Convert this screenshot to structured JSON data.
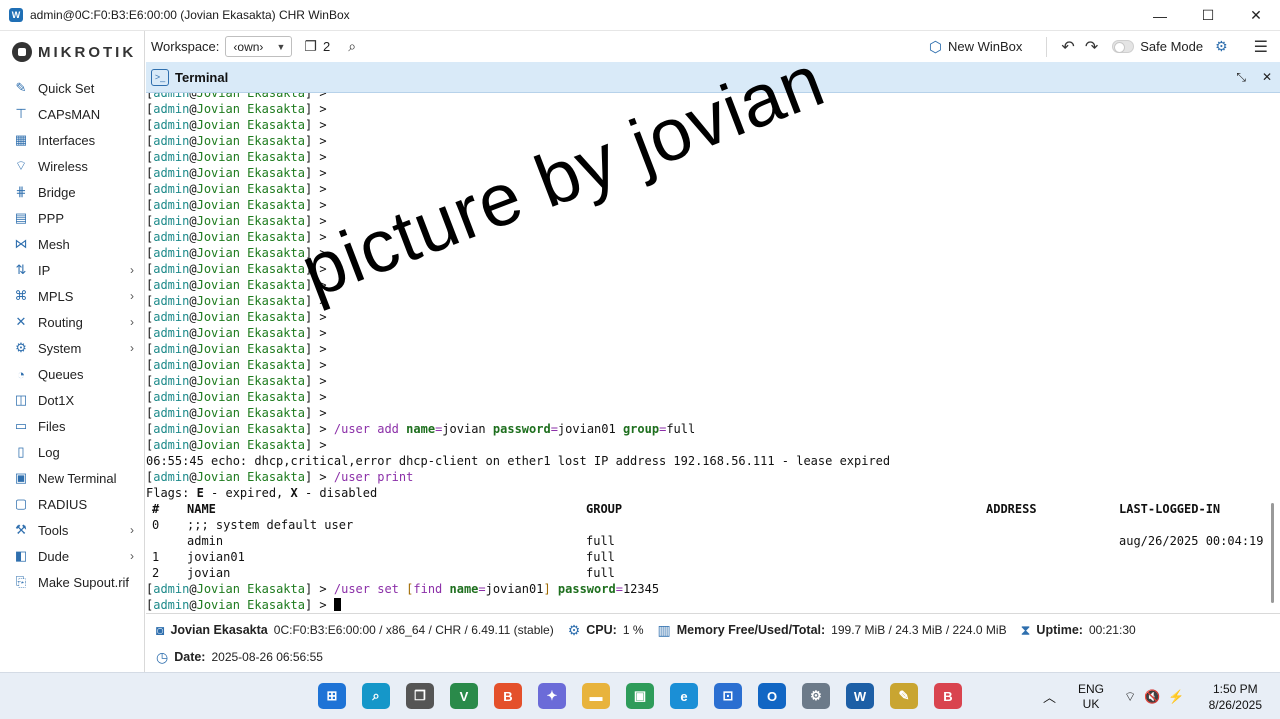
{
  "window": {
    "title": "admin@0C:F0:B3:E6:00:00 (Jovian Ekasakta) CHR WinBox",
    "controls": [
      "—",
      "☐",
      "✕"
    ]
  },
  "brand": {
    "logo_text": "MIKROTIK"
  },
  "sidebar": {
    "items": [
      {
        "label": "Quick Set",
        "icon": "magic-wand-icon",
        "glyph": "✎",
        "submenu": false
      },
      {
        "label": "CAPsMAN",
        "icon": "antenna-icon",
        "glyph": "⊤",
        "submenu": false
      },
      {
        "label": "Interfaces",
        "icon": "interfaces-icon",
        "glyph": "▦",
        "submenu": false
      },
      {
        "label": "Wireless",
        "icon": "wireless-icon",
        "glyph": "⌔",
        "submenu": false
      },
      {
        "label": "Bridge",
        "icon": "bridge-icon",
        "glyph": "⋕",
        "submenu": false
      },
      {
        "label": "PPP",
        "icon": "ppp-icon",
        "glyph": "▤",
        "submenu": false
      },
      {
        "label": "Mesh",
        "icon": "mesh-icon",
        "glyph": "⋈",
        "submenu": false
      },
      {
        "label": "IP",
        "icon": "ip-icon",
        "glyph": "⇅",
        "submenu": true
      },
      {
        "label": "MPLS",
        "icon": "mpls-icon",
        "glyph": "⌘",
        "submenu": true
      },
      {
        "label": "Routing",
        "icon": "routing-icon",
        "glyph": "✕",
        "submenu": true
      },
      {
        "label": "System",
        "icon": "system-gear-icon",
        "glyph": "⚙",
        "submenu": true
      },
      {
        "label": "Queues",
        "icon": "queues-icon",
        "glyph": "◔",
        "submenu": false
      },
      {
        "label": "Dot1X",
        "icon": "dot1x-icon",
        "glyph": "◫",
        "submenu": false
      },
      {
        "label": "Files",
        "icon": "folder-icon",
        "glyph": "▭",
        "submenu": false
      },
      {
        "label": "Log",
        "icon": "log-icon",
        "glyph": "▯",
        "submenu": false
      },
      {
        "label": "New Terminal",
        "icon": "terminal-icon",
        "glyph": "▣",
        "submenu": false
      },
      {
        "label": "RADIUS",
        "icon": "radius-icon",
        "glyph": "▢",
        "submenu": false
      },
      {
        "label": "Tools",
        "icon": "tools-icon",
        "glyph": "⚒",
        "submenu": true
      },
      {
        "label": "Dude",
        "icon": "dude-icon",
        "glyph": "◧",
        "submenu": true
      },
      {
        "label": "Make Supout.rif",
        "icon": "supout-icon",
        "glyph": "⎘",
        "submenu": false
      }
    ]
  },
  "toolbar": {
    "workspace_label": "Workspace:",
    "workspace_value": "‹own›",
    "window_count": "2",
    "new_winbox_label": "New WinBox",
    "safe_mode_label": "Safe Mode",
    "safe_mode_on": false
  },
  "terminal": {
    "title": "Terminal",
    "prompt_user": "admin",
    "prompt_host": "Jovian Ekasakta",
    "empty_prompt_count": 21,
    "cmd_add": {
      "path": "/user",
      "cmd": "add",
      "args": [
        [
          "name",
          "jovian"
        ],
        [
          "password",
          "jovian01"
        ],
        [
          "group",
          "full"
        ]
      ]
    },
    "echo_line": "06:55:45 echo: dhcp,critical,error dhcp-client on ether1 lost IP address 192.168.56.111 - lease expired",
    "cmd_print": {
      "path": "/user",
      "cmd": "print"
    },
    "flags": {
      "prefix": "Flags: ",
      "e": "E",
      "e_text": " - expired, ",
      "x": "X",
      "x_text": " - disabled"
    },
    "table": {
      "headers": [
        "#",
        "NAME",
        "GROUP",
        "ADDRESS",
        "LAST-LOGGED-IN"
      ],
      "comment": ";;; system default user",
      "rows": [
        {
          "num": "0",
          "name": "admin",
          "group": "full",
          "address": "",
          "last": "aug/26/2025 00:04:19"
        },
        {
          "num": "1",
          "name": "jovian01",
          "group": "full",
          "address": "",
          "last": ""
        },
        {
          "num": "2",
          "name": "jovian",
          "group": "full",
          "address": "",
          "last": ""
        }
      ]
    },
    "cmd_set": {
      "path": "/user",
      "cmd": "set",
      "find_open": "[",
      "find": "find",
      "find_key": "name",
      "find_val": "jovian01",
      "find_close": "]",
      "key": "password",
      "val": "12345"
    }
  },
  "watermark": "picture by jovian",
  "statusbar": {
    "identity": "Jovian Ekasakta",
    "board": "0C:F0:B3:E6:00:00 / x86_64 / CHR / 6.49.11 (stable)",
    "cpu_label": "CPU:",
    "cpu_value": "1 %",
    "memory_label": "Memory Free/Used/Total:",
    "memory_value": "199.7 MiB / 24.3 MiB / 224.0 MiB",
    "uptime_label": "Uptime:",
    "uptime_value": "00:21:30",
    "date_label": "Date:",
    "date_value": "2025-08-26 06:56:55"
  },
  "taskbar": {
    "apps": [
      {
        "name": "windows-start-icon",
        "glyph": "⊞",
        "color": "#1e73d6"
      },
      {
        "name": "search-icon",
        "glyph": "⌕",
        "color": "#1597c9"
      },
      {
        "name": "task-view-icon",
        "glyph": "❐",
        "color": "#555555"
      },
      {
        "name": "visual-studio-icon",
        "glyph": "V",
        "color": "#2a8a4a"
      },
      {
        "name": "brave-browser-icon",
        "glyph": "B",
        "color": "#e4502b"
      },
      {
        "name": "copilot-icon",
        "glyph": "✦",
        "color": "#6b6bd8"
      },
      {
        "name": "file-explorer-icon",
        "glyph": "▬",
        "color": "#e8b33c"
      },
      {
        "name": "terminal-app-icon",
        "glyph": "▣",
        "color": "#2e9c5a"
      },
      {
        "name": "edge-browser-icon",
        "glyph": "e",
        "color": "#1b8fd6"
      },
      {
        "name": "store-icon",
        "glyph": "⊡",
        "color": "#2b6fd1"
      },
      {
        "name": "outlook-icon",
        "glyph": "O",
        "color": "#1166c4"
      },
      {
        "name": "settings-icon",
        "glyph": "⚙",
        "color": "#6c7a89"
      },
      {
        "name": "winbox-icon",
        "glyph": "W",
        "color": "#1d5fa6"
      },
      {
        "name": "notepad-icon",
        "glyph": "✎",
        "color": "#c9a531"
      },
      {
        "name": "brave-beta-icon",
        "glyph": "B",
        "color": "#d9444f"
      }
    ],
    "language": "ENG",
    "region": "UK",
    "time": "1:50 PM",
    "date": "8/26/2025"
  }
}
